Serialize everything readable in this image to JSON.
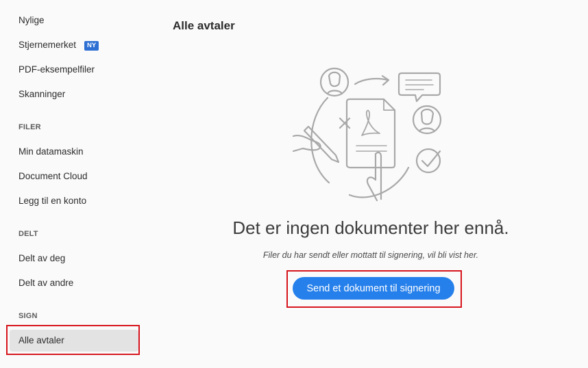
{
  "sidebar": {
    "recent": "Nylige",
    "starred": "Stjernemerket",
    "starred_badge": "NY",
    "pdf_samples": "PDF-eksempelfiler",
    "scans": "Skanninger",
    "files_header": "FILER",
    "my_computer": "Min datamaskin",
    "document_cloud": "Document Cloud",
    "add_account": "Legg til en konto",
    "shared_header": "DELT",
    "shared_by_you": "Delt av deg",
    "shared_by_others": "Delt av andre",
    "sign_header": "SIGN",
    "all_agreements": "Alle avtaler"
  },
  "main": {
    "title": "Alle avtaler",
    "empty_title": "Det er ingen dokumenter her ennå.",
    "empty_subtitle": "Filer du har sendt eller mottatt til signering, vil bli vist her.",
    "cta_label": "Send et dokument til signering"
  },
  "colors": {
    "accent": "#2680eb",
    "badge": "#2d6fd3",
    "highlight": "#d6141c",
    "selected_bg": "#e3e3e3"
  },
  "icons": [
    "person-icon",
    "arrow-right-icon",
    "chat-bubble-icon",
    "acrobat-document-icon",
    "pen-icon",
    "cross-mark-icon",
    "checkmark-icon",
    "hand-icon"
  ]
}
